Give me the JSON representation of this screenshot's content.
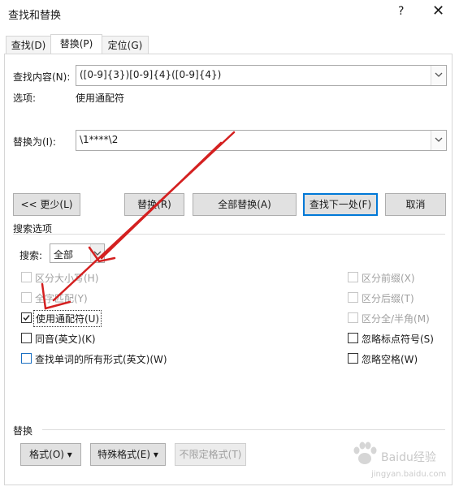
{
  "window": {
    "title": "查找和替换",
    "help": "?",
    "close": "✕"
  },
  "tabs": [
    {
      "label": "查找(D)"
    },
    {
      "label": "替换(P)"
    },
    {
      "label": "定位(G)"
    }
  ],
  "find": {
    "label": "查找内容(N):",
    "value": "([0-9]{3})[0-9]{4}([0-9]{4})",
    "options_label": "选项:",
    "options_value": "使用通配符"
  },
  "replace": {
    "label": "替换为(I):",
    "value": "\\1****\\2"
  },
  "buttons": {
    "less": "<< 更少(L)",
    "replace": "替换(R)",
    "replace_all": "全部替换(A)",
    "find_next": "查找下一处(F)",
    "cancel": "取消"
  },
  "search_options": {
    "heading": "搜索选项",
    "search_label": "搜索:",
    "search_value": "全部",
    "left": [
      {
        "label": "区分大小写(H)",
        "checked": false,
        "disabled": true
      },
      {
        "label": "全字匹配(Y)",
        "checked": false,
        "disabled": true
      },
      {
        "label": "使用通配符(U)",
        "checked": true,
        "disabled": false
      },
      {
        "label": "同音(英文)(K)",
        "checked": false,
        "disabled": false
      },
      {
        "label": "查找单词的所有形式(英文)(W)",
        "checked": false,
        "disabled": false
      }
    ],
    "right": [
      {
        "label": "区分前缀(X)",
        "checked": false,
        "disabled": true
      },
      {
        "label": "区分后缀(T)",
        "checked": false,
        "disabled": true
      },
      {
        "label": "区分全/半角(M)",
        "checked": false,
        "disabled": true
      },
      {
        "label": "忽略标点符号(S)",
        "checked": false,
        "disabled": false
      },
      {
        "label": "忽略空格(W)",
        "checked": false,
        "disabled": false
      }
    ]
  },
  "replace_section": {
    "heading": "替换",
    "format": "格式(O) ▾",
    "special": "特殊格式(E) ▾",
    "no_format": "不限定格式(T)"
  },
  "watermark": {
    "line1": "Baidu经验",
    "line2": "jingyan.baidu.com"
  },
  "colors": {
    "accent": "#0078d7",
    "arrow": "#d42020"
  }
}
